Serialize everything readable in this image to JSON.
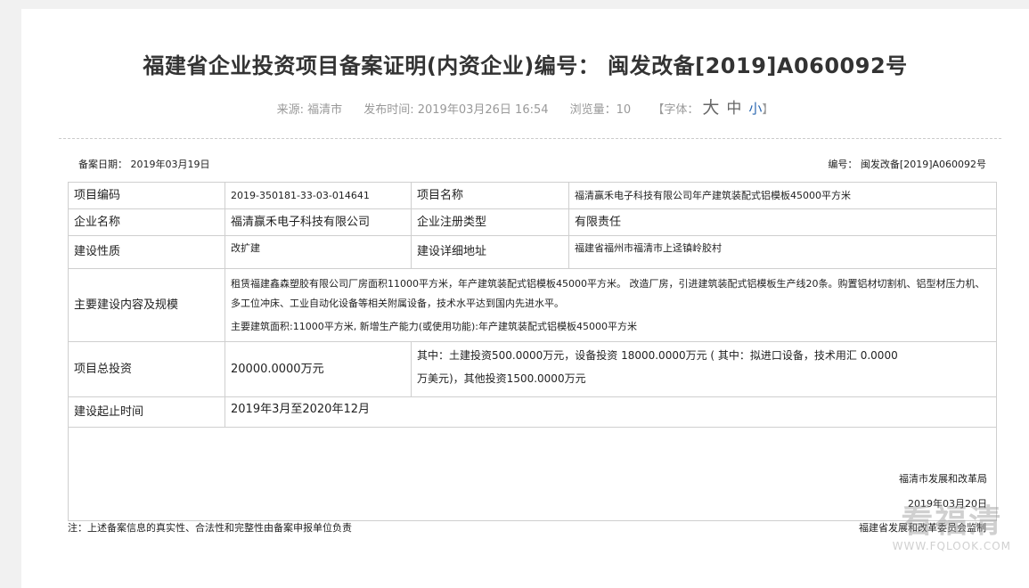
{
  "header": {
    "title": "福建省企业投资项目备案证明(内资企业)编号： 闽发改备[2019]A060092号"
  },
  "meta": {
    "source": "来源: 福清市",
    "publish_time": "发布时间: 2019年03月26日 16:54",
    "views": "浏览量：10",
    "font_label_open": "【字体：",
    "font_big": "大",
    "font_mid": "中",
    "font_small": "小",
    "font_label_close": "】"
  },
  "record": {
    "date": "备案日期： 2019年03月19日",
    "number": "编号： 闽发改备[2019]A060092号"
  },
  "table": {
    "r1_l1": "项目编码",
    "r1_v1": "2019-350181-33-03-014641",
    "r1_l2": "项目名称",
    "r1_v2": "福清赢禾电子科技有限公司年产建筑装配式铝模板45000平方米",
    "r2_l1": "企业名称",
    "r2_v1": "福清赢禾电子科技有限公司",
    "r2_l2": "企业注册类型",
    "r2_v2": "有限责任",
    "r3_l1": "建设性质",
    "r3_v1": "改扩建",
    "r3_l2": "建设详细地址",
    "r3_v2": "福建省福州市福清市上迳镇岭胶村",
    "r4_l1": "主要建设内容及规模",
    "r4_p1": "租赁福建鑫森塑胶有限公司厂房面积11000平方米，年产建筑装配式铝模板45000平方米。 改造厂房，引进建筑装配式铝模板生产线20条。购置铝材切割机、铝型材压力机、多工位冲床、工业自动化设备等相关附属设备，技术水平达到国内先进水平。",
    "r4_p2": "主要建筑面积:11000平方米, 新增生产能力(或使用功能):年产建筑装配式铝模板45000平方米",
    "r5_l1": "项目总投资",
    "r5_v1": "20000.0000万元",
    "r5_v2a": "其中：土建投资500.0000万元，设备投资 18000.0000万元 ( 其中：拟进口设备，技术用汇 0.0000",
    "r5_v2b": "万美元)，其他投资1500.0000万元",
    "r6_l1": "建设起止时间",
    "r6_v1": "2019年3月至2020年12月",
    "sign_org": "福清市发展和改革局",
    "sign_date": "2019年03月20日"
  },
  "footer": {
    "note": "注：上述备案信息的真实性、合法性和完整性由备案申报单位负责",
    "producer": "福建省发展和改革委员会监制"
  },
  "watermark": {
    "logo": "看福清",
    "url": "WWW.FQLOOK.COM"
  }
}
